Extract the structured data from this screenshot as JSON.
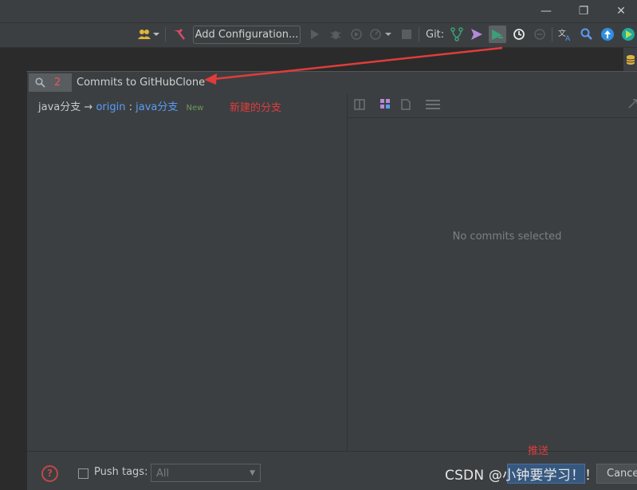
{
  "titlebar": {
    "minimize_glyph": "—",
    "restore_glyph": "❐",
    "close_glyph": "✕"
  },
  "toolbar": {
    "add_configuration": "Add Configuration...",
    "git_label": "Git:",
    "accent_green": "#3d9e7a",
    "accent_purple": "#b48ad8"
  },
  "dialog": {
    "search_count": "2",
    "title": "Commits to GitHubClone",
    "branch": {
      "local": "java分支",
      "arrow": "→",
      "remote": "origin",
      "colon": ":",
      "remote_branch": "java分支",
      "badge": "New"
    },
    "annotation_new_branch": "新建的分支",
    "empty_state": "No commits selected",
    "footer": {
      "push_tags_label": "Push tags:",
      "tags_select_value": "All",
      "cancel_label": "Cance",
      "annotation_push": "推送"
    }
  },
  "watermark": "CSDN @小钟要学习！！",
  "colors": {
    "annotation_red": "#e03c3c",
    "link_blue": "#589df6",
    "dialog_bg": "#3c3f41",
    "editor_bg": "#2b2b2b"
  }
}
